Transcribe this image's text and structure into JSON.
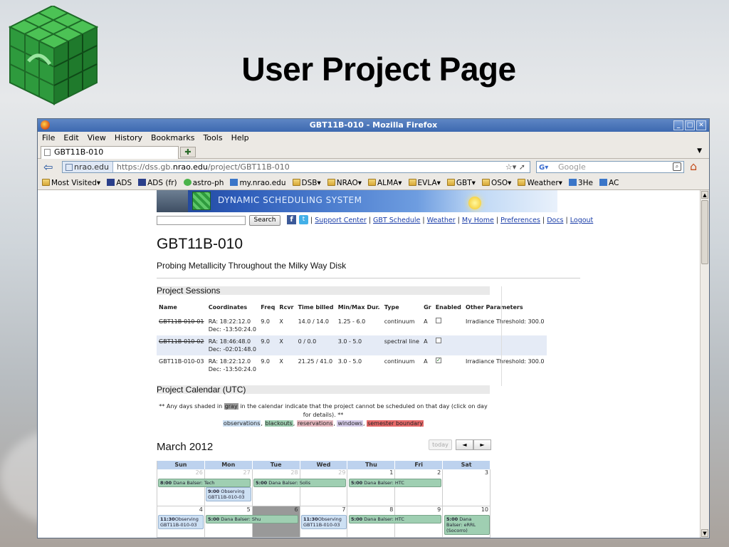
{
  "slide": {
    "title": "User Project Page"
  },
  "window": {
    "title": "GBT11B-010 - Mozilla Firefox",
    "buttons": [
      "_",
      "□",
      "✕"
    ]
  },
  "menu": [
    "File",
    "Edit",
    "View",
    "History",
    "Bookmarks",
    "Tools",
    "Help"
  ],
  "tab": {
    "label": "GBT11B-010"
  },
  "nav": {
    "site": "nrao.edu",
    "url_prefix": "https://dss.gb.",
    "url_domain": "nrao.edu",
    "url_path": "/project/GBT11B-010",
    "search_placeholder": "Google"
  },
  "bookmarks": [
    "Most Visited▾",
    "ADS",
    "ADS (fr)",
    "astro-ph",
    "my.nrao.edu",
    "DSB▾",
    "NRAO▾",
    "ALMA▾",
    "EVLA▾",
    "GBT▾",
    "OSO▾",
    "Weather▾",
    "3He",
    "AC"
  ],
  "banner": {
    "text": "DYNAMIC SCHEDULING SYSTEM"
  },
  "search_button": "Search",
  "toplinks": [
    "Support Center",
    "GBT Schedule",
    "Weather",
    "My Home",
    "Preferences",
    "Docs",
    "Logout"
  ],
  "project": {
    "code": "GBT11B-010",
    "title": "Probing Metallicity Throughout the Milky Way Disk"
  },
  "sessions_header": "Project Sessions",
  "sessions_columns": [
    "Name",
    "Coordinates",
    "Freq",
    "Rcvr",
    "Time billed",
    "Min/Max Dur.",
    "Type",
    "Gr",
    "Enabled",
    "Other Parameters"
  ],
  "sessions": [
    {
      "name": "GBT11B-010-01",
      "ra": "RA: 18:22:12.0",
      "dec": "Dec: -13:50:24.0",
      "freq": "9.0",
      "rcvr": "X",
      "time": "14.0 / 14.0",
      "dur": "1.25 - 6.0",
      "type": "continuum",
      "gr": "A",
      "enabled": false,
      "other": "Irradiance Threshold: 300.0",
      "struck": true
    },
    {
      "name": "GBT11B-010-02",
      "ra": "RA: 18:46:48.0",
      "dec": "Dec: -02:01:48.0",
      "freq": "9.0",
      "rcvr": "X",
      "time": "0 / 0.0",
      "dur": "3.0 - 5.0",
      "type": "spectral line",
      "gr": "A",
      "enabled": false,
      "other": "",
      "struck": true
    },
    {
      "name": "GBT11B-010-03",
      "ra": "RA: 18:22:12.0",
      "dec": "Dec: -13:50:24.0",
      "freq": "9.0",
      "rcvr": "X",
      "time": "21.25 / 41.0",
      "dur": "3.0 - 5.0",
      "type": "continuum",
      "gr": "A",
      "enabled": true,
      "other": "Irradiance Threshold: 300.0",
      "struck": false
    }
  ],
  "calendar_header": "Project Calendar (UTC)",
  "calendar_note": {
    "pre": "** Any days shaded in ",
    "gray": "gray",
    "post": " in the calendar indicate that the project cannot be scheduled on that day (click on day for details). **",
    "legend": [
      "observations",
      "blackouts",
      "reservations",
      "windows",
      "semester boundary"
    ]
  },
  "month": "March 2012",
  "today_label": "today",
  "nav_prev": "◄",
  "nav_next": "►",
  "weekdays": [
    "Sun",
    "Mon",
    "Tue",
    "Wed",
    "Thu",
    "Fri",
    "Sat"
  ],
  "weeks": [
    {
      "days": [
        "26",
        "27",
        "28",
        "29",
        "1",
        "2",
        "3"
      ],
      "other": [
        true,
        true,
        true,
        true,
        false,
        false,
        false
      ],
      "gray": [
        false,
        false,
        false,
        false,
        false,
        false,
        false
      ]
    },
    {
      "days": [
        "4",
        "5",
        "6",
        "7",
        "8",
        "9",
        "10"
      ],
      "other": [
        false,
        false,
        false,
        false,
        false,
        false,
        false
      ],
      "gray": [
        false,
        false,
        true,
        false,
        false,
        false,
        false
      ]
    }
  ],
  "events": {
    "w1_blk1": {
      "time": "8:00",
      "text": "Dana Balser: Tech"
    },
    "w1_blk2": {
      "time": "5:00",
      "text": "Dana Balser: Solis"
    },
    "w1_blk3": {
      "time": "5:00",
      "text": "Dana Balser: HTC"
    },
    "w1_obs1": {
      "time": "9:00",
      "text": "Observing GBT11B-010-03"
    },
    "w2_obs1": {
      "time": "11:30",
      "text": "Observing GBT11B-010-03"
    },
    "w2_blk1": {
      "time": "5:00",
      "text": "Dana Balser: Shu"
    },
    "w2_obs2": {
      "time": "11:30",
      "text": "Observing GBT11B-010-03"
    },
    "w2_blk2": {
      "time": "5:00",
      "text": "Dana Balser: HTC"
    },
    "w2_blk3": {
      "time": "5:00",
      "text": "Dana Balser: eRRL (Socorro)"
    }
  }
}
